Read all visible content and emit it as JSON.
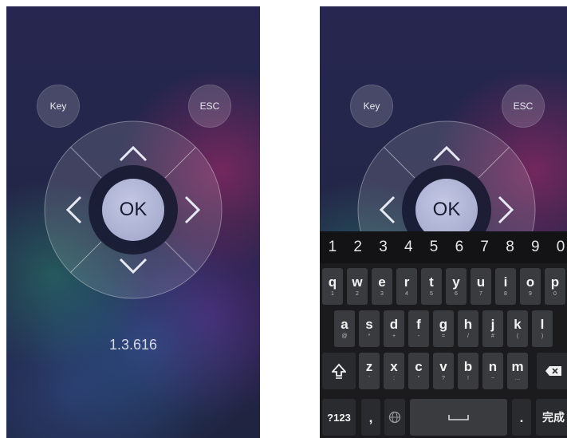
{
  "remote": {
    "key_label": "Key",
    "esc_label": "ESC",
    "ok_label": "OK",
    "version": "1.3.616"
  },
  "keyboard": {
    "number_row": [
      "1",
      "2",
      "3",
      "4",
      "5",
      "6",
      "7",
      "8",
      "9",
      "0"
    ],
    "row1": [
      {
        "main": "q",
        "sub": "1"
      },
      {
        "main": "w",
        "sub": "2"
      },
      {
        "main": "e",
        "sub": "3"
      },
      {
        "main": "r",
        "sub": "4"
      },
      {
        "main": "t",
        "sub": "5"
      },
      {
        "main": "y",
        "sub": "6"
      },
      {
        "main": "u",
        "sub": "7"
      },
      {
        "main": "i",
        "sub": "8"
      },
      {
        "main": "o",
        "sub": "9"
      },
      {
        "main": "p",
        "sub": "0"
      }
    ],
    "row2": [
      {
        "main": "a",
        "sub": "@"
      },
      {
        "main": "s",
        "sub": "*"
      },
      {
        "main": "d",
        "sub": "+"
      },
      {
        "main": "f",
        "sub": "-"
      },
      {
        "main": "g",
        "sub": "="
      },
      {
        "main": "h",
        "sub": "/"
      },
      {
        "main": "j",
        "sub": "#"
      },
      {
        "main": "k",
        "sub": "("
      },
      {
        "main": "l",
        "sub": ")"
      }
    ],
    "row3": [
      {
        "main": "z",
        "sub": "'"
      },
      {
        "main": "x",
        "sub": ":"
      },
      {
        "main": "c",
        "sub": "\""
      },
      {
        "main": "v",
        "sub": "?"
      },
      {
        "main": "b",
        "sub": "!"
      },
      {
        "main": "n",
        "sub": "~"
      },
      {
        "main": "m",
        "sub": "…"
      }
    ],
    "symbols_label": "?123",
    "comma_label": ",",
    "period_label": ".",
    "done_label": "完成"
  },
  "colors": {
    "background_top": "#262650",
    "ok_button": "#b4b8d8",
    "key": "#3a3b3f",
    "keyboard_bg": "#1b1b1e"
  }
}
